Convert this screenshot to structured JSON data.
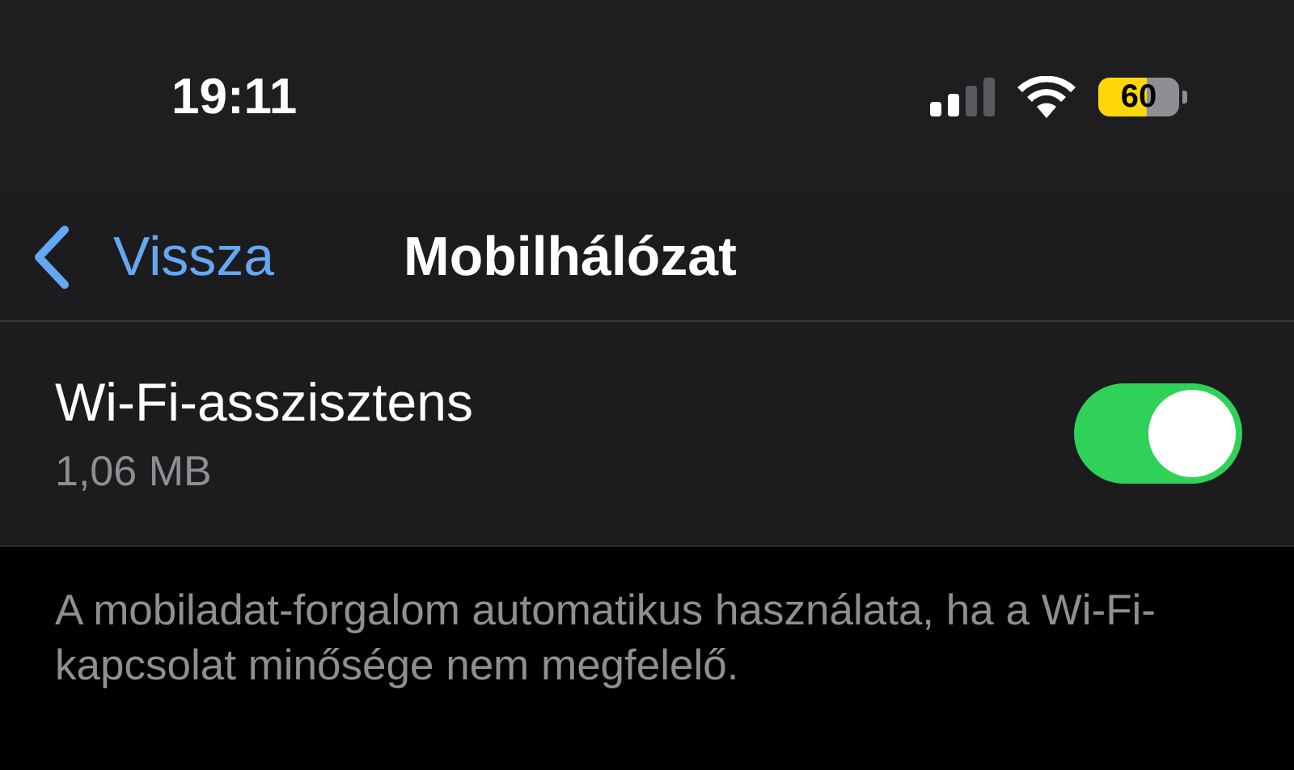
{
  "status_bar": {
    "time": "19:11",
    "battery": "60"
  },
  "nav": {
    "back": "Vissza",
    "title": "Mobilhálózat"
  },
  "setting": {
    "label": "Wi-Fi-asszisztens",
    "detail": "1,06 MB",
    "on": true
  },
  "footer": "A mobiladat-forgalom automatikus használata, ha a Wi-Fi-kapcsolat minősége nem megfelelő."
}
